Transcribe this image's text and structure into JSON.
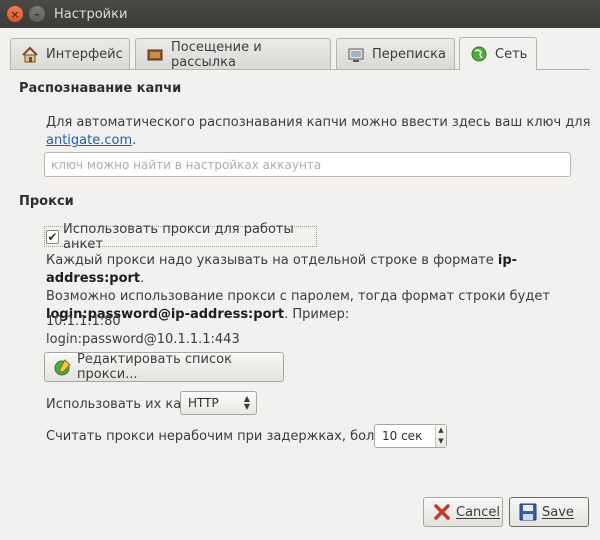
{
  "window": {
    "title": "Настройки"
  },
  "tabs": [
    {
      "label": "Интерфейс",
      "icon": "home-icon",
      "active": false
    },
    {
      "label": "Посещение и рассылка",
      "icon": "mail-icon",
      "active": false
    },
    {
      "label": "Переписка",
      "icon": "monitor-icon",
      "active": false
    },
    {
      "label": "Сеть",
      "icon": "network-globe-icon",
      "active": true
    }
  ],
  "captcha": {
    "title": "Распознавание капчи",
    "description": "Для автоматического распознавания капчи можно ввести здесь ваш ключ для",
    "link": "antigate.com",
    "link_suffix": ".",
    "key_value": "",
    "key_placeholder": "ключ можно найти в настройках аккаунта"
  },
  "proxy": {
    "title": "Прокси",
    "use_checkbox_label": "Использовать прокси для работы анкет",
    "use_checked": true,
    "desc_line1_prefix": "Каждый прокси надо указывать на отдельной строке в формате ",
    "desc_line1_bold": "ip-address:port",
    "desc_line1_suffix": ".",
    "desc_line2": "Возможно использование прокси с паролем, тогда формат строки будет",
    "desc_line3_bold": "login:password@ip-address:port",
    "desc_line3_suffix": ". Пример:",
    "example1": "10.1.1.1:80",
    "example2": "login:password@10.1.1.1:443",
    "edit_button": "Редактировать список прокси...",
    "use_as_label": "Использовать их как",
    "use_as_value": "HTTP",
    "timeout_label": "Считать прокси нерабочим при задержках, больше",
    "timeout_value": "10 сек"
  },
  "buttons": {
    "cancel": "Cancel",
    "save": "Save"
  },
  "colors": {
    "titlebar": "#3c3b37",
    "close": "#e95420",
    "link": "#1f5fb0"
  }
}
